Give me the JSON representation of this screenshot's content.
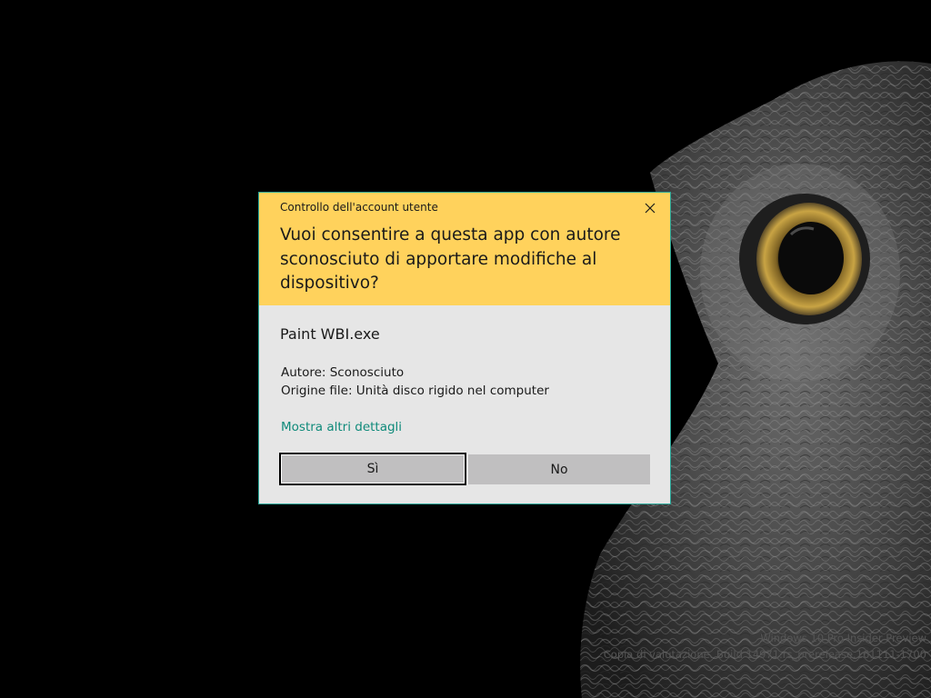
{
  "dialog": {
    "title": "Controllo dell'account utente",
    "question": "Vuoi consentire a questa app con autore sconosciuto di apportare modifiche al dispositivo?",
    "app_name": "Paint WBI.exe",
    "publisher": "Autore: Sconosciuto",
    "origin": "Origine file: Unità disco rigido nel computer",
    "details_link": "Mostra altri dettagli",
    "yes_label": "Sì",
    "no_label": "No",
    "close_icon": "close-icon"
  },
  "watermark": {
    "line1": "Windows 10 Pro Insider Preview",
    "line2": "Copia di valutazione. Build 14971.rs_prerelease.161111-1700"
  },
  "colors": {
    "header": "#ffd25c",
    "body": "#e6e6e6",
    "border": "#2aa89a",
    "link": "#0f8a7a",
    "button": "#c0bfc0",
    "desktop": "#000000"
  }
}
